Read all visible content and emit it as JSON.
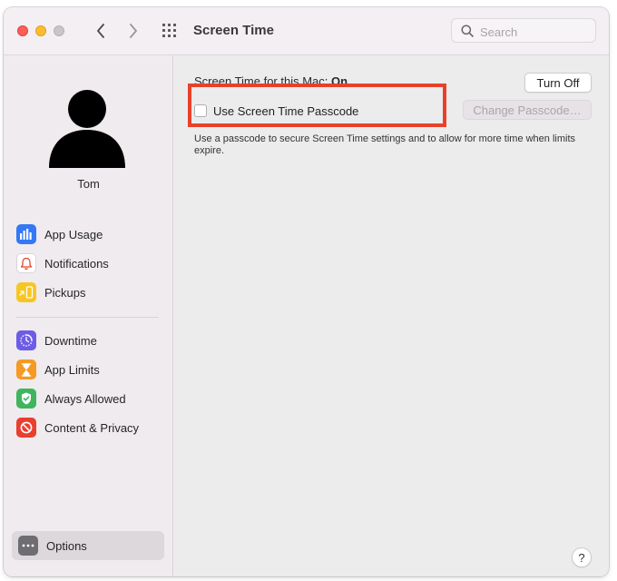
{
  "window": {
    "title": "Screen Time"
  },
  "search": {
    "placeholder": "Search"
  },
  "user": {
    "name": "Tom"
  },
  "sidebar": {
    "items": [
      {
        "label": "App Usage",
        "icon": "bar-chart-icon",
        "color": "#3478f6"
      },
      {
        "label": "Notifications",
        "icon": "bell-icon",
        "color": "#ffffff"
      },
      {
        "label": "Pickups",
        "icon": "pickup-phone-icon",
        "color": "#f7c623"
      },
      {
        "label": "Downtime",
        "icon": "downtime-icon",
        "color": "#6e5ce6"
      },
      {
        "label": "App Limits",
        "icon": "hourglass-icon",
        "color": "#f59a22"
      },
      {
        "label": "Always Allowed",
        "icon": "checkmark-shield-icon",
        "color": "#3fb65d"
      },
      {
        "label": "Content & Privacy",
        "icon": "no-entry-icon",
        "color": "#ea3e2f"
      }
    ],
    "options_label": "Options"
  },
  "main": {
    "status_prefix": "Screen Time for this Mac:",
    "status_value": "On",
    "turn_off_label": "Turn Off",
    "passcode_label": "Use Screen Time Passcode",
    "passcode_checked": false,
    "change_passcode_label": "Change Passcode…",
    "description": "Use a passcode to secure Screen Time settings and to allow for more time when limits expire.",
    "help_label": "?"
  },
  "colors": {
    "accent_highlight": "#e8412b"
  }
}
